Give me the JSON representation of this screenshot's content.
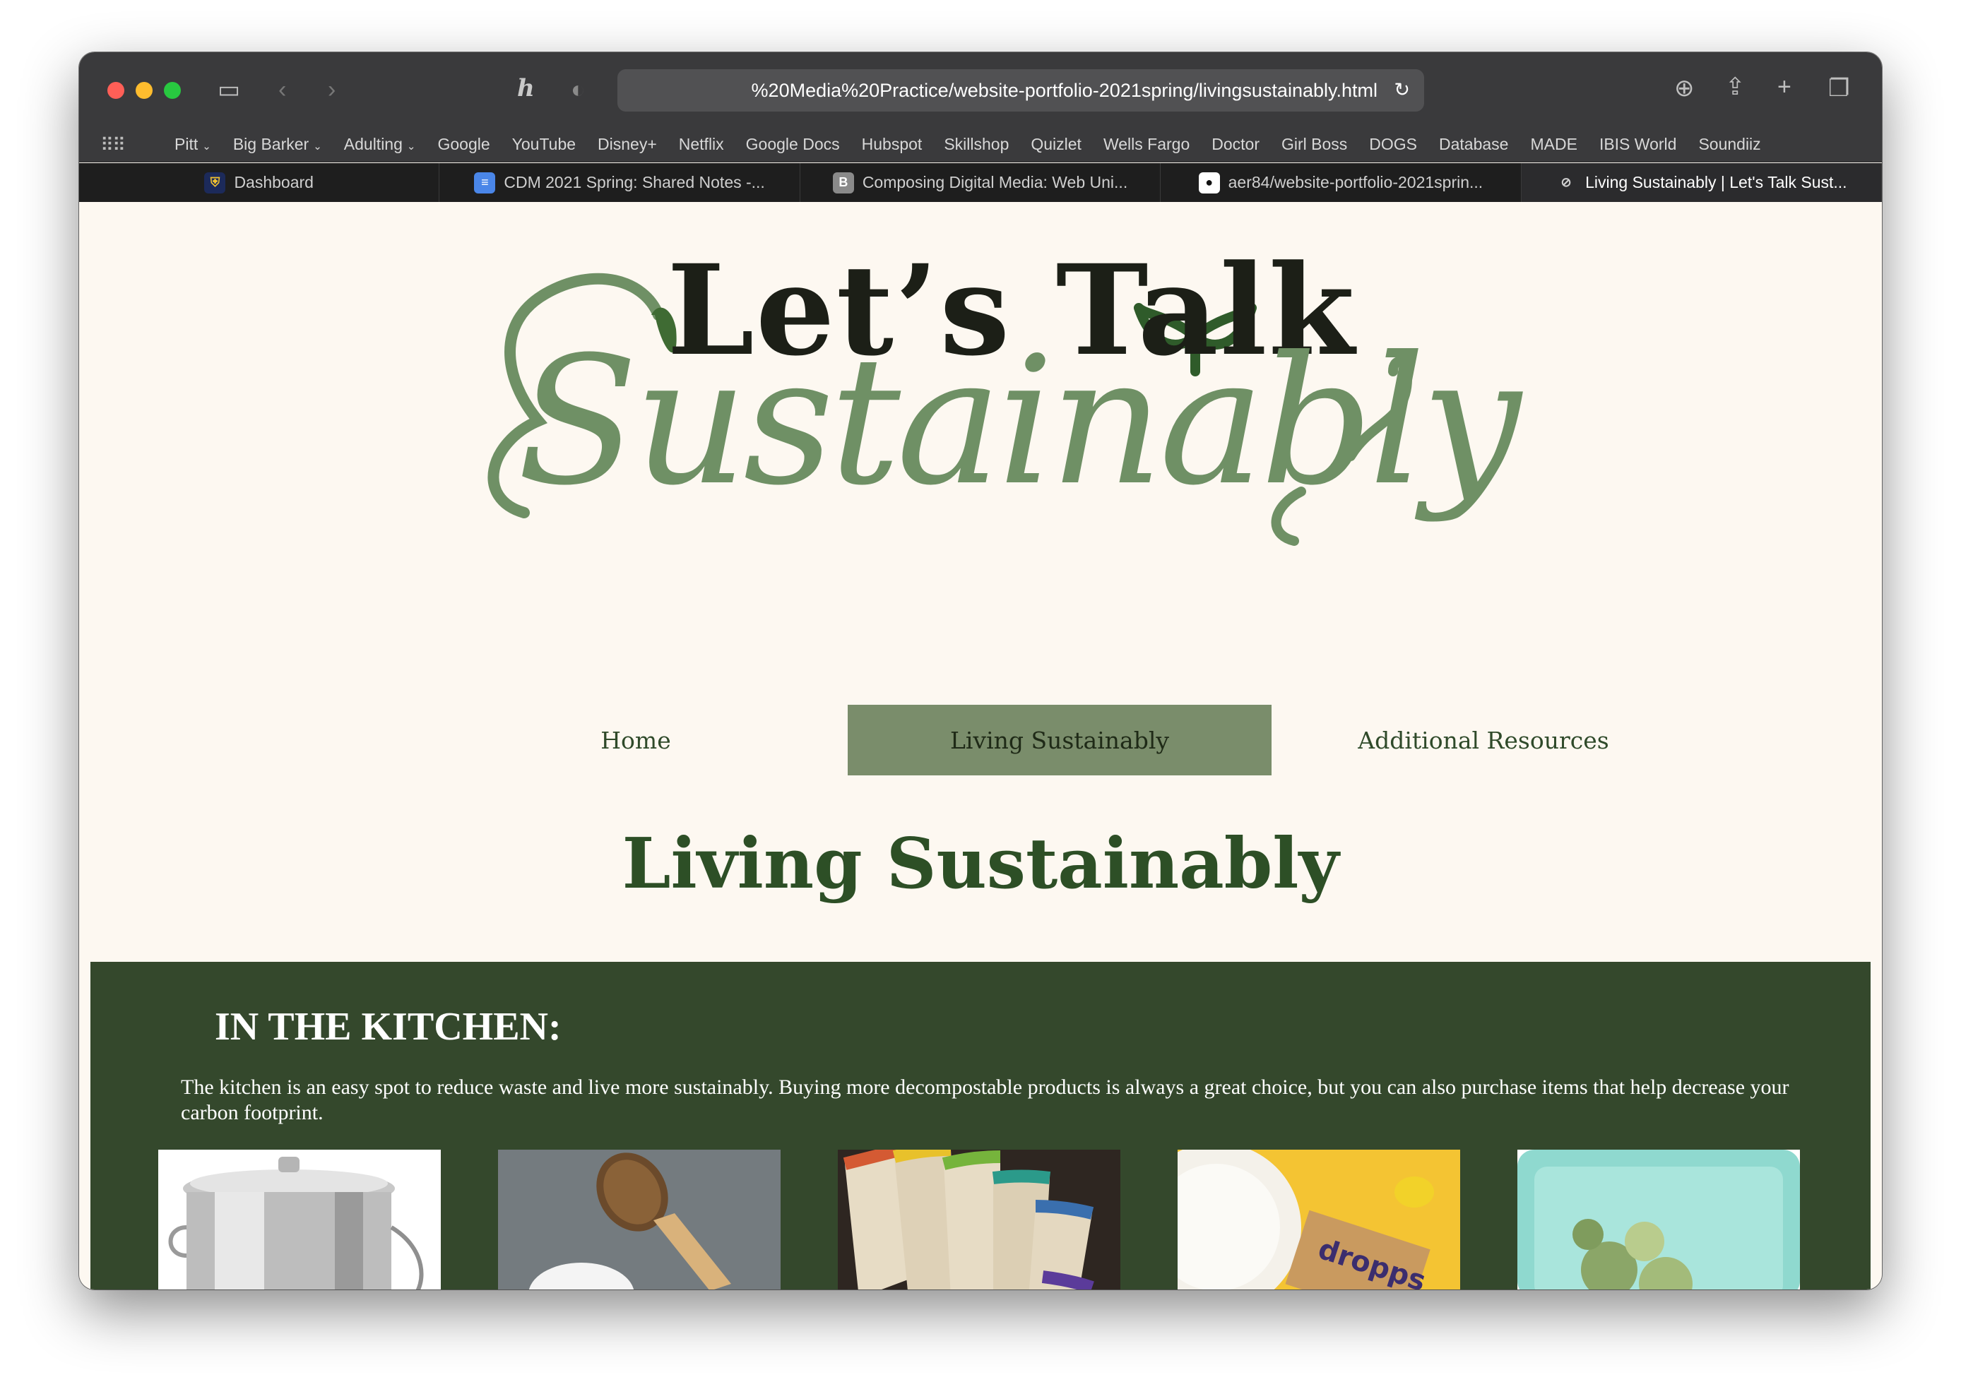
{
  "browser": {
    "address_text": "%20Media%20Practice/website-portfolio-2021spring/livingsustainably.html",
    "bookmarks": [
      {
        "label": "Pitt",
        "dropdown": true
      },
      {
        "label": "Big Barker",
        "dropdown": true
      },
      {
        "label": "Adulting",
        "dropdown": true
      },
      {
        "label": "Google"
      },
      {
        "label": "YouTube"
      },
      {
        "label": "Disney+"
      },
      {
        "label": "Netflix"
      },
      {
        "label": "Google Docs"
      },
      {
        "label": "Hubspot"
      },
      {
        "label": "Skillshop"
      },
      {
        "label": "Quizlet"
      },
      {
        "label": "Wells Fargo"
      },
      {
        "label": "Doctor"
      },
      {
        "label": "Girl Boss"
      },
      {
        "label": "DOGS"
      },
      {
        "label": "Database"
      },
      {
        "label": "MADE"
      },
      {
        "label": "IBIS World"
      },
      {
        "label": "Soundiiz"
      }
    ],
    "tabs": [
      {
        "label": "Dashboard",
        "icon": "pitt-shield-icon"
      },
      {
        "label": "CDM 2021 Spring: Shared Notes -...",
        "icon": "google-docs-icon"
      },
      {
        "label": "Composing Digital Media: Web Uni...",
        "icon": "bootstrap-icon"
      },
      {
        "label": "aer84/website-portfolio-2021sprin...",
        "icon": "github-icon"
      },
      {
        "label": "Living Sustainably | Let's Talk Sust...",
        "icon": "compass-icon",
        "active": true
      }
    ]
  },
  "site": {
    "logo_line1": "Let’s Talk",
    "logo_line2": "Sustainably",
    "nav": {
      "home": "Home",
      "living": "Living Sustainably",
      "resources": "Additional Resources"
    },
    "page_title": "Living Sustainably",
    "section": {
      "heading": "IN THE KITCHEN:",
      "body": "The kitchen is an easy spot to reduce waste and live more sustainably. Buying more decompostable products is always a great choice, but you can also purchase items that help decrease your carbon footprint.",
      "products": [
        {
          "icon": "compost-bin-image"
        },
        {
          "icon": "dish-brush-image"
        },
        {
          "icon": "reusable-produce-bags-image"
        },
        {
          "icon": "dropps-detergent-image",
          "brand_text": "dropps"
        },
        {
          "icon": "silicone-food-bag-image"
        }
      ]
    }
  },
  "colors": {
    "nav_active_bg": "#7a8d6b",
    "title_green": "#2d4f26",
    "section_bg": "#34482c",
    "page_bg": "#fdf8f1",
    "script_green": "#6f9065"
  }
}
